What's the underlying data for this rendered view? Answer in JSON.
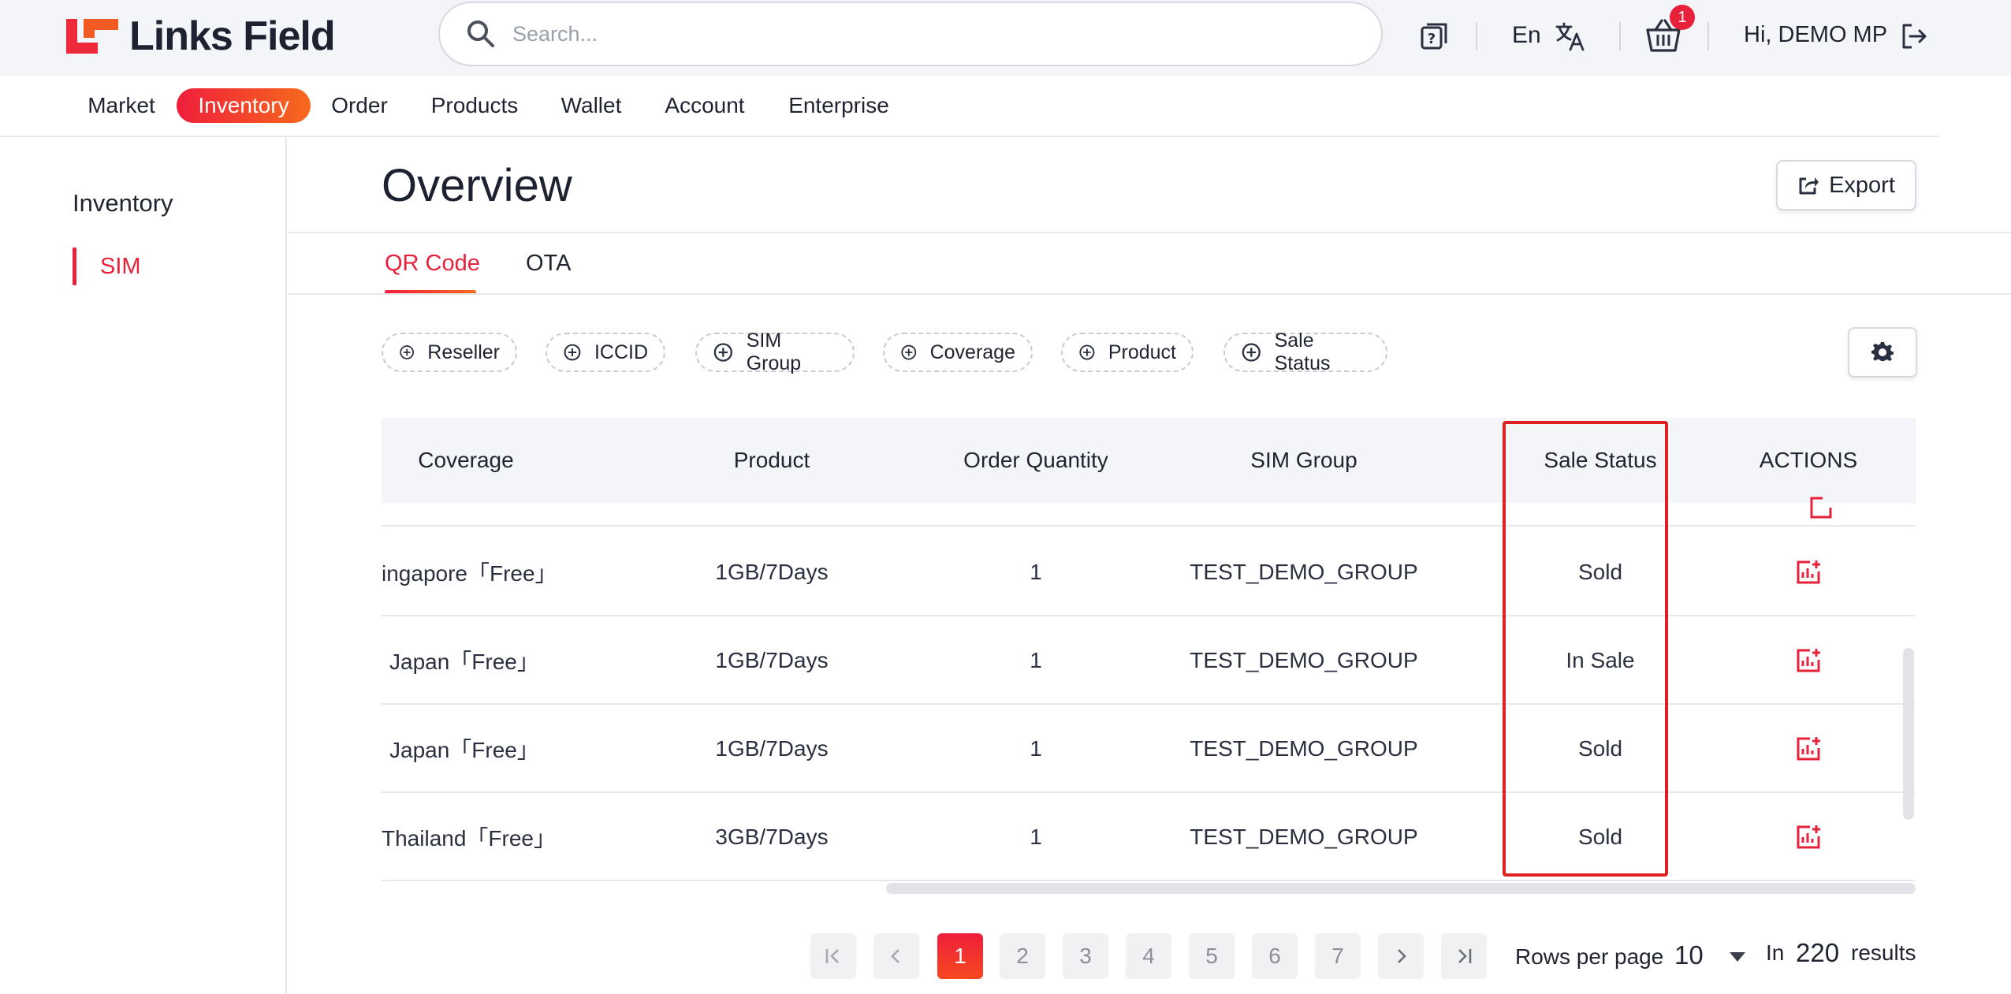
{
  "brand": {
    "name": "Links Field"
  },
  "search": {
    "placeholder": "Search..."
  },
  "header": {
    "language": "En",
    "cart_count": "1",
    "greeting": "Hi, DEMO MP"
  },
  "nav": {
    "items": [
      {
        "label": "Market"
      },
      {
        "label": "Inventory"
      },
      {
        "label": "Order"
      },
      {
        "label": "Products"
      },
      {
        "label": "Wallet"
      },
      {
        "label": "Account"
      },
      {
        "label": "Enterprise"
      }
    ],
    "active": "Inventory"
  },
  "sidebar": {
    "title": "Inventory",
    "items": [
      {
        "label": "SIM"
      }
    ]
  },
  "page": {
    "title": "Overview",
    "export_label": "Export"
  },
  "tabs": [
    {
      "label": "QR Code"
    },
    {
      "label": "OTA"
    }
  ],
  "filters": [
    {
      "label": "Reseller"
    },
    {
      "label": "ICCID"
    },
    {
      "label": "SIM Group"
    },
    {
      "label": "Coverage"
    },
    {
      "label": "Product"
    },
    {
      "label": "Sale Status"
    }
  ],
  "table": {
    "columns": [
      "Coverage",
      "Product",
      "Order Quantity",
      "SIM Group",
      "Sale Status",
      "ACTIONS"
    ],
    "rows": [
      {
        "coverage": "ingapore「Free」",
        "product": "1GB/7Days",
        "quantity": "1",
        "group": "TEST_DEMO_GROUP",
        "status": "Sold"
      },
      {
        "coverage": "Japan「Free」",
        "product": "1GB/7Days",
        "quantity": "1",
        "group": "TEST_DEMO_GROUP",
        "status": "In Sale"
      },
      {
        "coverage": "Japan「Free」",
        "product": "1GB/7Days",
        "quantity": "1",
        "group": "TEST_DEMO_GROUP",
        "status": "Sold"
      },
      {
        "coverage": "Thailand「Free」",
        "product": "3GB/7Days",
        "quantity": "1",
        "group": "TEST_DEMO_GROUP",
        "status": "Sold"
      }
    ]
  },
  "pagination": {
    "pages": [
      "1",
      "2",
      "3",
      "4",
      "5",
      "6",
      "7"
    ],
    "current": "1",
    "rows_per_page_label": "Rows per page",
    "rows_per_page": "10",
    "results_prefix": "In",
    "total": "220",
    "results_suffix": "results"
  },
  "colors": {
    "accent": "#e8213a",
    "accent_gradient_end": "#f66a1c",
    "highlight_box": "#e02020"
  }
}
